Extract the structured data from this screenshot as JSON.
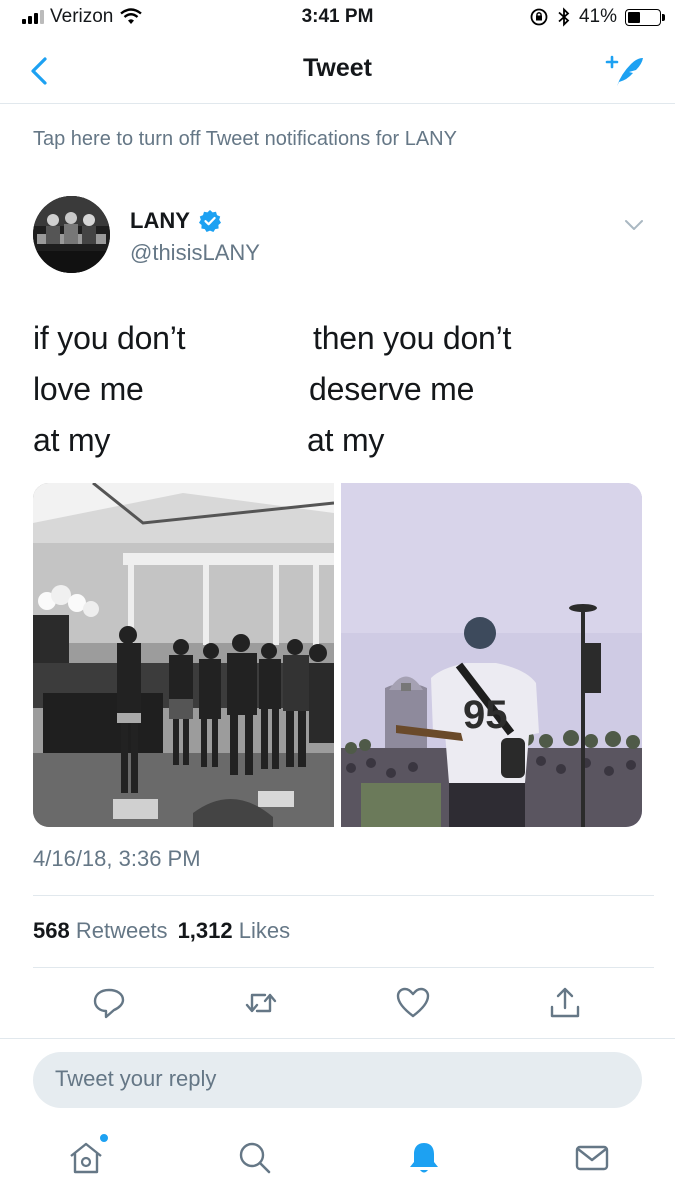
{
  "status_bar": {
    "carrier": "Verizon",
    "time": "3:41 PM",
    "battery_percent": "41%",
    "battery_level": 0.41
  },
  "nav": {
    "title": "Tweet",
    "back_icon": "chevron-left-icon",
    "compose_icon": "compose-tweet-icon"
  },
  "notification_banner": "Tap here to turn off Tweet notifications for LANY",
  "tweet": {
    "author_name": "LANY",
    "author_handle": "@thisisLANY",
    "verified": true,
    "text_left": [
      "if you don’t",
      "love me",
      "at my"
    ],
    "text_right": [
      "then you don’t",
      "deserve me",
      "at my"
    ],
    "timestamp": "4/16/18, 3:36 PM",
    "retweets_count": "568",
    "retweets_label": "Retweets",
    "likes_count": "1,312",
    "likes_label": "Likes"
  },
  "actions": [
    "reply-icon",
    "retweet-icon",
    "like-icon",
    "share-icon"
  ],
  "reply_placeholder": "Tweet your reply",
  "tab_bar": [
    "home-icon",
    "search-icon",
    "notifications-icon",
    "messages-icon"
  ],
  "colors": {
    "accent": "#1da1f2",
    "secondary_text": "#657786",
    "divider": "#e1e8ed",
    "reply_box": "#e6ecf0"
  }
}
